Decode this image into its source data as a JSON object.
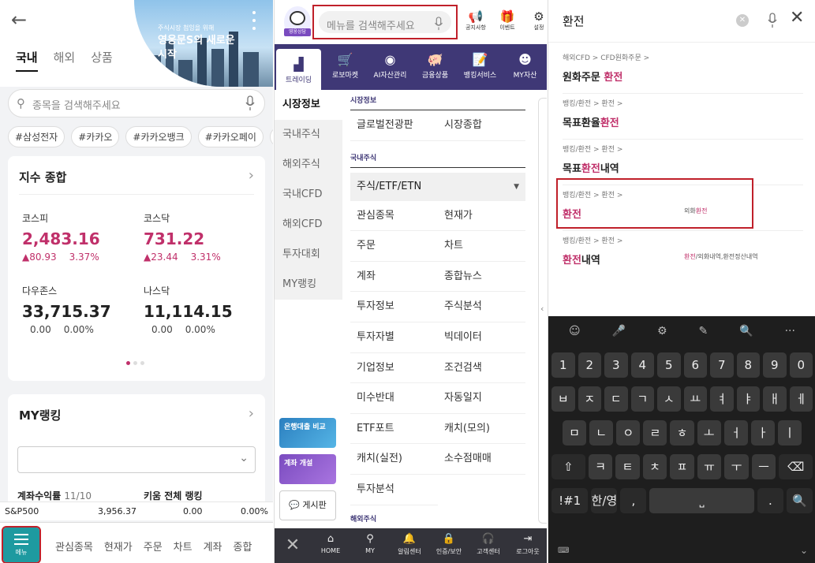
{
  "p1": {
    "tabs": [
      "국내",
      "해외",
      "상품"
    ],
    "banner": {
      "small": "주식시장 첨잉을 위해",
      "title": "영웅문S의 새로운 시작"
    },
    "search_placeholder": "종목을 검색해주세요",
    "tags": [
      "#삼성전자",
      "#카카오",
      "#카카오뱅크",
      "#카카오페이",
      "#"
    ],
    "index_card": {
      "title": "지수 종합",
      "items": [
        {
          "name": "코스피",
          "value": "2,483.16",
          "arrow": "▲",
          "change": "80.93",
          "pct": "3.37%",
          "state": "up"
        },
        {
          "name": "코스닥",
          "value": "731.22",
          "arrow": "▲",
          "change": "23.44",
          "pct": "3.31%",
          "state": "up"
        },
        {
          "name": "다우존스",
          "value": "33,715.37",
          "arrow": "",
          "change": "0.00",
          "pct": "0.00%",
          "state": "flat"
        },
        {
          "name": "나스닥",
          "value": "11,114.15",
          "arrow": "",
          "change": "0.00",
          "pct": "0.00%",
          "state": "flat"
        }
      ]
    },
    "ranking": {
      "title": "MY랭킹",
      "sub1": "계좌수익률",
      "sub1_muted": "11/10",
      "sub2": "키움 전체 랭킹"
    },
    "ticker": {
      "name": "S&P500",
      "value": "3,956.37",
      "change": "0.00",
      "pct": "0.00%"
    },
    "menu_label": "메뉴",
    "bottom_nav": [
      "관심종목",
      "현재가",
      "주문",
      "차트",
      "계좌",
      "종합"
    ]
  },
  "p2": {
    "mascot_label": "영웅상담",
    "search_placeholder": "메뉴를 검색해주세요",
    "header_icons": [
      {
        "icon": "megaphone-icon",
        "glyph": "📢",
        "label": "공지사항"
      },
      {
        "icon": "gift-icon",
        "glyph": "🎁",
        "label": "이벤트"
      },
      {
        "icon": "gear-icon",
        "glyph": "⚙",
        "label": "설정"
      }
    ],
    "categories": [
      {
        "icon": "chart-icon",
        "glyph": "▟",
        "label": "트레이딩"
      },
      {
        "icon": "cart-icon",
        "glyph": "🛒",
        "label": "로보마켓"
      },
      {
        "icon": "ai-icon",
        "glyph": "◉",
        "label": "AI자산관리"
      },
      {
        "icon": "piggy-bank-icon",
        "glyph": "🐖",
        "label": "금융상품"
      },
      {
        "icon": "document-icon",
        "glyph": "📝",
        "label": "뱅킹서비스"
      },
      {
        "icon": "person-icon",
        "glyph": "☻",
        "label": "MY자산"
      }
    ],
    "side_items": [
      "시장정보",
      "국내주식",
      "해외주식",
      "국내CFD",
      "해외CFD",
      "투자대회",
      "MY랭킹"
    ],
    "sections": {
      "market_title": "시장정보",
      "market_items": [
        "글로벌전광판",
        "시장종합"
      ],
      "domestic_title": "국내주식",
      "dropdown": "주식/ETF/ETN",
      "domestic_items": [
        "관심종목",
        "현재가",
        "주문",
        "차트",
        "계좌",
        "종합뉴스",
        "투자정보",
        "주식분석",
        "투자자별",
        "빅데이터",
        "기업정보",
        "조건검색",
        "미수반대",
        "자동일지",
        "ETF포트",
        "캐치(모의)",
        "캐치(실전)",
        "소수점매매",
        "투자분석"
      ],
      "overseas_title": "해외주식"
    },
    "ads": [
      "은행대출 비교",
      "계좌 개설"
    ],
    "board_btn": "게시판",
    "bottom_nav": [
      {
        "icon": "home-icon",
        "glyph": "⌂",
        "label": "HOME"
      },
      {
        "icon": "person-icon",
        "glyph": "⚲",
        "label": "MY"
      },
      {
        "icon": "bell-icon",
        "glyph": "🔔",
        "label": "알림센터"
      },
      {
        "icon": "lock-icon",
        "glyph": "🔒",
        "label": "인증/보안"
      },
      {
        "icon": "headset-icon",
        "glyph": "🎧",
        "label": "고객센터"
      },
      {
        "icon": "logout-icon",
        "glyph": "⇥",
        "label": "로그아웃"
      }
    ]
  },
  "p3": {
    "query": "환전",
    "results": [
      {
        "path": "해외CFD > CFD원화주문 >",
        "pre": "원화주문 ",
        "hl": "환전",
        "post": "",
        "side_hl": "",
        "side_post": "",
        "side_pre": ""
      },
      {
        "path": "뱅킹/환전 > 환전 >",
        "pre": "목표환율",
        "hl": "환전",
        "post": "",
        "side_hl": "",
        "side_post": "",
        "side_pre": ""
      },
      {
        "path": "뱅킹/환전 > 환전 >",
        "pre": "목표",
        "hl": "환전",
        "post": "내역",
        "side_hl": "",
        "side_post": "",
        "side_pre": ""
      },
      {
        "path": "뱅킹/환전 > 환전 >",
        "pre": "",
        "hl": "환전",
        "post": "",
        "side_pre": "외화",
        "side_hl": "환전",
        "side_post": ""
      },
      {
        "path": "뱅킹/환전 > 환전 >",
        "pre": "",
        "hl": "환전",
        "post": "내역",
        "side_pre": "",
        "side_hl": "환전",
        "side_post": "/외화내역,환전정산내역"
      }
    ],
    "keyboard": {
      "numbers": [
        "1",
        "2",
        "3",
        "4",
        "5",
        "6",
        "7",
        "8",
        "9",
        "0"
      ],
      "row1": [
        "ㅂ",
        "ㅈ",
        "ㄷ",
        "ㄱ",
        "ㅅ",
        "ㅛ",
        "ㅕ",
        "ㅑ",
        "ㅐ",
        "ㅔ"
      ],
      "row2": [
        "ㅁ",
        "ㄴ",
        "ㅇ",
        "ㄹ",
        "ㅎ",
        "ㅗ",
        "ㅓ",
        "ㅏ",
        "ㅣ"
      ],
      "row3": [
        "⇧",
        "ㅋ",
        "ㅌ",
        "ㅊ",
        "ㅍ",
        "ㅠ",
        "ㅜ",
        "ㅡ",
        "⌫"
      ],
      "row4": [
        "!#1",
        "한/영",
        ",",
        "⎵",
        ".",
        "🔍"
      ],
      "tools": [
        "☺",
        "🎤",
        "⚙",
        "✎",
        "🔍",
        "···"
      ]
    }
  }
}
